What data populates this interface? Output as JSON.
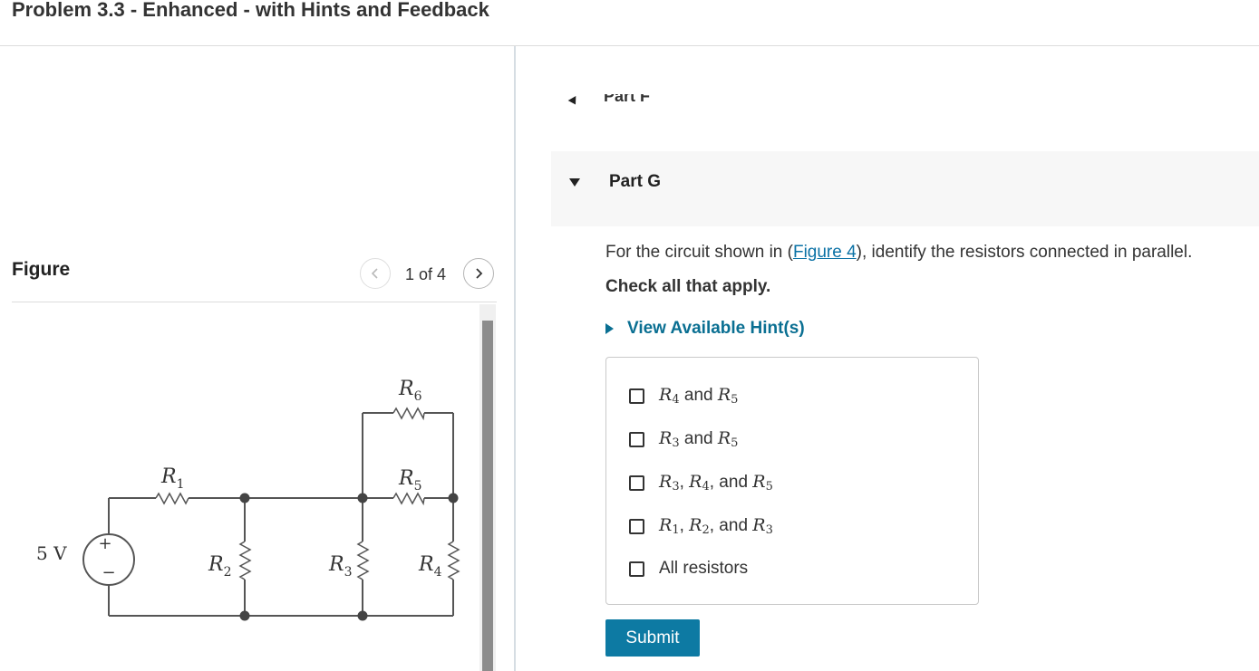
{
  "header": {
    "title": "Problem 3.3 - Enhanced - with Hints and Feedback"
  },
  "figure": {
    "label": "Figure",
    "pager": "1 of 4",
    "circuit": {
      "source": "5 V",
      "source_plus": "+",
      "source_minus": "−",
      "resistors": [
        {
          "letter": "R",
          "sub": "1"
        },
        {
          "letter": "R",
          "sub": "2"
        },
        {
          "letter": "R",
          "sub": "3"
        },
        {
          "letter": "R",
          "sub": "4"
        },
        {
          "letter": "R",
          "sub": "5"
        },
        {
          "letter": "R",
          "sub": "6"
        }
      ]
    }
  },
  "part_f": {
    "label": "Part F"
  },
  "part_g": {
    "label": "Part G",
    "question_before": "For the circuit shown in (",
    "question_link": "Figure 4",
    "question_after": "), identify the resistors connected in parallel.",
    "instruction": "Check all that apply.",
    "hints_label": "View Available Hint(s)",
    "options": [
      {
        "a": "R",
        "as": "4",
        "joiner": " and ",
        "b": "R",
        "bs": "5"
      },
      {
        "a": "R",
        "as": "3",
        "joiner": " and ",
        "b": "R",
        "bs": "5"
      },
      {
        "a": "R",
        "as": "3",
        "sep": ", ",
        "b": "R",
        "bs": "4",
        "joiner": ", and ",
        "c": "R",
        "cs": "5"
      },
      {
        "a": "R",
        "as": "1",
        "sep": ", ",
        "b": "R",
        "bs": "2",
        "joiner": ", and ",
        "c": "R",
        "cs": "3"
      },
      {
        "text": "All resistors"
      }
    ],
    "submit_label": "Submit"
  }
}
